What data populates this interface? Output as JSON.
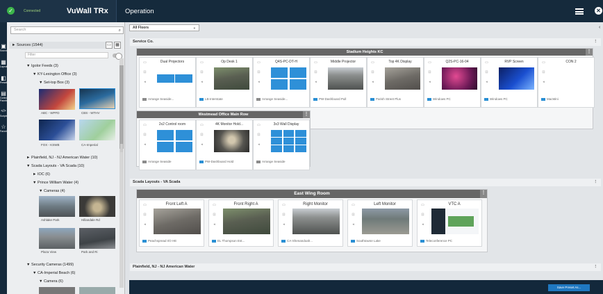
{
  "topbar": {
    "connected_label": "Connected",
    "app_title": "VuWall TRx",
    "section_title": "Operation"
  },
  "rail": [
    {
      "label": "Sources",
      "glyph": "▣"
    },
    {
      "label": "Layouts",
      "glyph": "▦"
    },
    {
      "label": "Presets",
      "glyph": "◧"
    },
    {
      "label": "Control Panels",
      "glyph": "▤"
    },
    {
      "label": "Scripts",
      "glyph": "</>"
    },
    {
      "label": "Favorites",
      "glyph": "☆"
    }
  ],
  "sidebar": {
    "search_placeholder": "Search",
    "sources_header": "Sources (1544)",
    "filter_placeholder": "Filter",
    "tree": [
      "Igolor Feeds (3)",
      "KY-Lexington Office (3)",
      "Set-top Box (3)",
      "Plainfield, NJ - NJ American Water (10)",
      "Scada Layouts - VA Scada (10)",
      "IOC (6)",
      "Prince William Water (4)",
      "Cameras (4)",
      "Security Cameras (1499)",
      "CA-Imperial Beach (6)",
      "Camera (6)"
    ],
    "thumbs": [
      "ABC - WPFD",
      "CBS - WTHV",
      "FOX - KSWB",
      "CA-Imperial",
      "Ashlake Park",
      "Hillandale Rd",
      "Plaza View",
      "Park and Ri"
    ]
  },
  "main": {
    "floor_select": "All Floors",
    "groups": [
      {
        "title": "Service Co."
      },
      {
        "title": "Scada Layouts - VA Scada"
      },
      {
        "title": "Plainfield, NJ - NJ American Water"
      }
    ],
    "walls": {
      "w1": {
        "title": "Stadium Heights KC",
        "cells": [
          {
            "title": "Dual Projectors",
            "footer": "Arrange Seaside...",
            "kind": "dual"
          },
          {
            "title": "Op Desk 1",
            "footer": "LB-Interstate",
            "kind": "road"
          },
          {
            "title": "Q4S-PC-DT-H",
            "footer": "Arrange Seaside...",
            "kind": "quad"
          },
          {
            "title": "Middle Projector",
            "footer": "PW-Dashboard Pull",
            "kind": "city"
          },
          {
            "title": "Top 4K Display",
            "footer": "Parish Street Plus",
            "kind": "traffic"
          },
          {
            "title": "Q2S-PC-16-04",
            "footer": "Windows PC",
            "kind": "pink"
          },
          {
            "title": "RVP Screen",
            "footer": "Windows PC",
            "kind": "win"
          },
          {
            "title": "CON 2",
            "footer": "MacMini",
            "kind": "blank"
          }
        ]
      },
      "w2": {
        "title": "Westmead Office Main Row",
        "cells": [
          {
            "title": "2x2 Control room",
            "footer": "Arrange Seaside",
            "kind": "quad"
          },
          {
            "title": "4K Monitor Hold...",
            "footer": "PW-Dashboard Hold",
            "kind": "tunnel"
          },
          {
            "title": "3x3 Wall Display",
            "footer": "Arrange Seaside",
            "kind": "grid9"
          }
        ]
      },
      "w3": {
        "title": "East Wing Room",
        "cells": [
          {
            "title": "Front Left A",
            "footer": "Peachspread I/O HE",
            "kind": "traffic"
          },
          {
            "title": "Front Right A",
            "footer": "EL Thompson Est...",
            "kind": "road"
          },
          {
            "title": "Right Monitor",
            "footer": "CA-Shenandoah...",
            "kind": "city"
          },
          {
            "title": "Left Monitor",
            "footer": "Southtowne Lake",
            "kind": "lot"
          },
          {
            "title": "VTC A",
            "footer": "Teleconference PC",
            "kind": "vtc"
          }
        ]
      }
    },
    "bottom_button": "Save Preset As..."
  },
  "colors": {
    "accent": "#2e90d8",
    "topbar": "#152a3c",
    "connected": "#3cb54a"
  }
}
